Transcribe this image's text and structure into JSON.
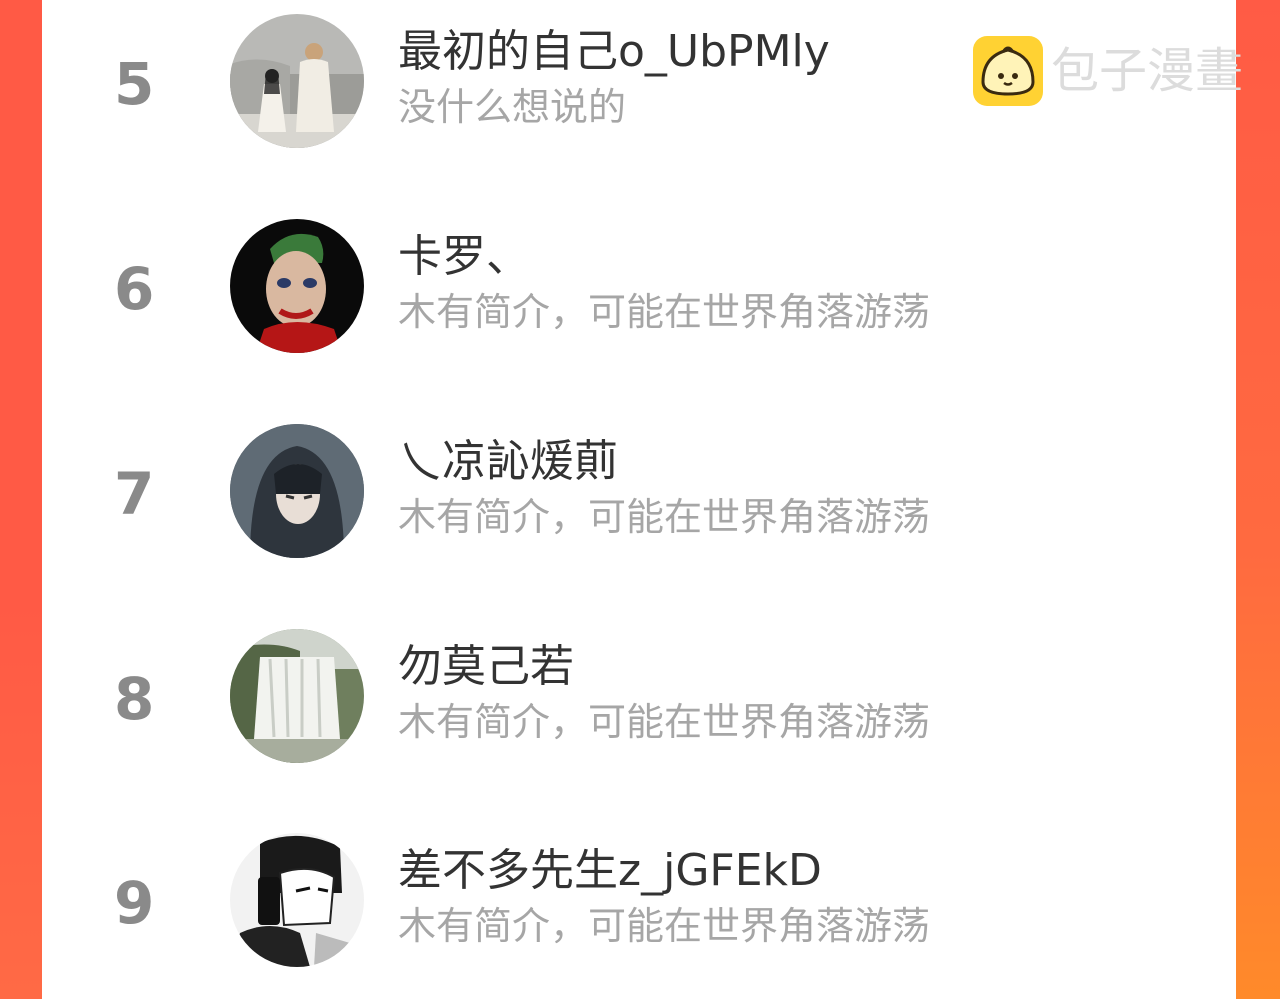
{
  "colors": {
    "accent_left": "#ff5a45",
    "accent_right": "#ff8a2a",
    "rank": "#8a8a8a",
    "name": "#333333",
    "bio": "#a6a6a6"
  },
  "watermark": {
    "icon": "bun-logo-icon",
    "text": "包子漫畫"
  },
  "ranking": [
    {
      "rank": "5",
      "name": "最初的自己o_UbPMly",
      "bio": "没什么想说的",
      "avatar": "couple-illustration-avatar"
    },
    {
      "rank": "6",
      "name": "卡罗、",
      "bio": "木有简介，可能在世界角落游荡",
      "avatar": "joker-avatar"
    },
    {
      "rank": "7",
      "name": "乀凉訫煖萴",
      "bio": "木有简介，可能在世界角落游荡",
      "avatar": "anime-hooded-avatar"
    },
    {
      "rank": "8",
      "name": "勿莫己若",
      "bio": "木有简介，可能在世界角落游荡",
      "avatar": "waterfall-avatar"
    },
    {
      "rank": "9",
      "name": "差不多先生z_jGFEkD",
      "bio": "木有简介，可能在世界角落游荡",
      "avatar": "manga-phone-avatar"
    }
  ]
}
